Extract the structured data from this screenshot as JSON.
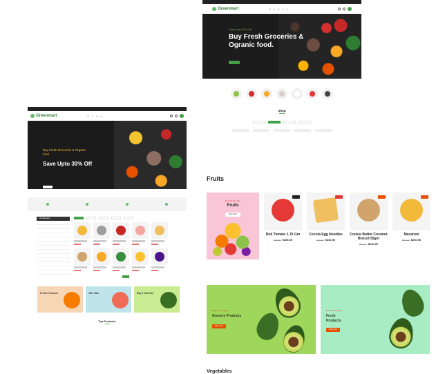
{
  "left_preview": {
    "brand": "Greenmart",
    "hero": {
      "kicker": "Buy Fresh Groceries & Organic food.",
      "title": "Save Upto 30% Off"
    },
    "section_title": "Top Products",
    "banners": [
      {
        "title": "Fresh Products",
        "color": "#f7d6b5"
      },
      {
        "title": "15% Sale",
        "color": "#bfe4ea"
      },
      {
        "title": "Buy 1 Get One",
        "color": "#c9ec92"
      }
    ],
    "sidebar_head": "All Categories"
  },
  "right_preview": {
    "brand": "Greenmart",
    "hero": {
      "kicker": "Save upto 30% off",
      "title": "Buy Fresh Groceries & Ogranic food."
    },
    "shop_title": "Shop",
    "fruits": {
      "title": "Fruits",
      "banner": {
        "small": "Deal Of The Day",
        "big": "Fruits",
        "button": "Shop Now"
      },
      "products": [
        {
          "name": "Red Tomato  1 25 Gm",
          "old": "$359.00",
          "new": "$335.00",
          "color": "#e53935",
          "badge_color": "#212121"
        },
        {
          "name": "Cocola Egg Noodles",
          "old": "$359.00",
          "new": "$340.00",
          "color": "#f0c060",
          "badge_color": "#e53935"
        },
        {
          "name": "Cookie Butter Coconut Biscuit 55gm",
          "old": "$359.00",
          "new": "$240.00",
          "color": "#d1a36d",
          "badge_color": "#e65100"
        },
        {
          "name": "Macaroni",
          "old": "$359.00",
          "new": "$240.00",
          "color": "#f2b93b",
          "badge_color": "#e65100"
        }
      ]
    },
    "promos": [
      {
        "small": "Deal Of The Day",
        "big": "Grocery Products",
        "button": "Shop Now",
        "bg": "#9ed75b"
      },
      {
        "small": "Deal Of The Day",
        "big": "Fresh Products",
        "button": "Shop Now",
        "bg": "#a8ecc4"
      }
    ],
    "next_section": "Vegetables"
  },
  "colors": {
    "accent": "#43a047",
    "dark": "#1c1c1c"
  }
}
